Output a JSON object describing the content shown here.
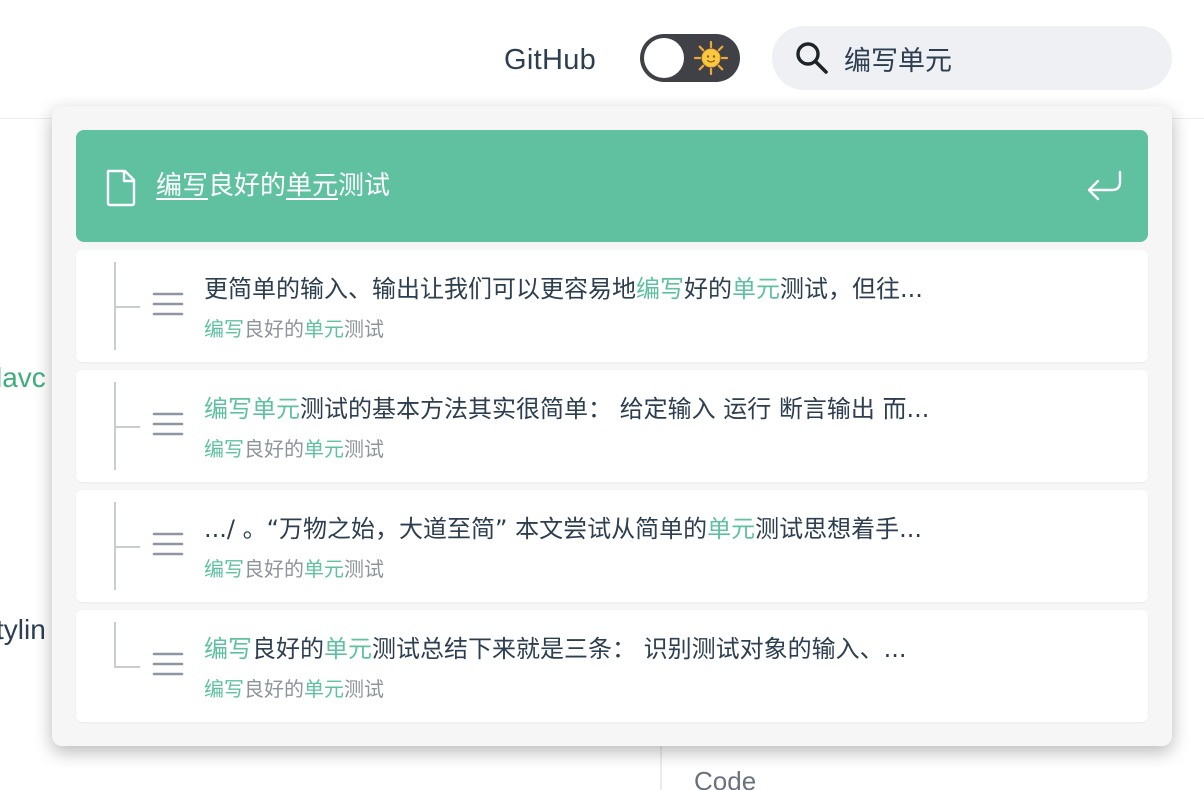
{
  "navbar": {
    "github_label": "GitHub",
    "theme_toggle": {
      "icon": "sun-icon",
      "state": "light"
    },
    "search": {
      "icon": "search-icon",
      "value": "编写单元"
    }
  },
  "background": {
    "fragment_1": "lavc",
    "fragment_2": "tylin",
    "fragment_3": "Code"
  },
  "dropdown": {
    "top_hit": {
      "icon": "document-icon",
      "title_parts": [
        "编写",
        "良好的",
        "单元",
        "测试"
      ],
      "enter_icon": "enter-icon"
    },
    "results": [
      {
        "text_parts": [
          "更简单的输入、输出让我们可以更容易地",
          "编写",
          "好的",
          "单元",
          "测试，但往..."
        ],
        "page_parts": [
          "编写",
          "良好的",
          "单元",
          "测试"
        ]
      },
      {
        "text_parts": [
          "",
          "编写单元",
          "测试的基本方法其实很简单： 给定输入 运行 断言输出 而..."
        ],
        "page_parts": [
          "编写",
          "良好的",
          "单元",
          "测试"
        ]
      },
      {
        "text_parts": [
          ".../ 。“万物之始，大道至简” 本文尝试从简单的",
          "单元",
          "测试思想着手..."
        ],
        "page_parts": [
          "编写",
          "良好的",
          "单元",
          "测试"
        ]
      },
      {
        "text_parts": [
          "",
          "编写",
          "良好的",
          "单元",
          "测试总结下来就是三条： 识别测试对象的输入、..."
        ],
        "page_parts": [
          "编写",
          "良好的",
          "单元",
          "测试"
        ]
      }
    ]
  },
  "colors": {
    "accent": "#5fc1a0",
    "text": "#2c3e50",
    "muted": "#8e949c",
    "toggle_bg": "#3f4147",
    "search_bg": "#eef0f3",
    "dropdown_bg": "#f6f6f7"
  }
}
